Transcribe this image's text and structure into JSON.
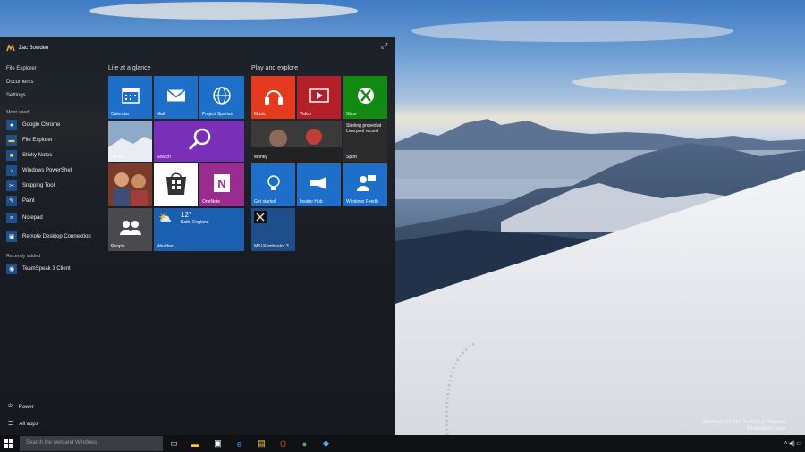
{
  "user": {
    "name": "Zac Bowden"
  },
  "places": [
    "File Explorer",
    "Documents",
    "Settings"
  ],
  "most_used_label": "Most used",
  "most_used": [
    {
      "label": "Google Chrome",
      "icon": "chrome-icon"
    },
    {
      "label": "File Explorer",
      "icon": "folder-icon"
    },
    {
      "label": "Sticky Notes",
      "icon": "sticky-notes-icon"
    },
    {
      "label": "Windows PowerShell",
      "icon": "powershell-icon"
    },
    {
      "label": "Snipping Tool",
      "icon": "scissors-icon"
    },
    {
      "label": "Paint",
      "icon": "paint-icon"
    },
    {
      "label": "Notepad",
      "icon": "notepad-icon"
    },
    {
      "label": "Remote Desktop Connection",
      "icon": "remote-desktop-icon"
    }
  ],
  "recently_added_label": "Recently added",
  "recently_added": [
    {
      "label": "TeamSpeak 3 Client",
      "icon": "teamspeak-icon"
    }
  ],
  "power_label": "Power",
  "all_apps_label": "All apps",
  "groups": {
    "life": "Life at a glance",
    "play": "Play and explore"
  },
  "tiles": {
    "calendar": "Calendar",
    "mail": "Mail",
    "spartan": "Project Spartan",
    "photos": "Photos",
    "search": "Search",
    "store": "Store",
    "onenote": "OneNote",
    "people": "People",
    "weather": "Weather",
    "weather_temp": "12°",
    "weather_loc": "Bath, England",
    "music": "Music",
    "video": "Video",
    "xbox": "Xbox",
    "money": "Money",
    "sport": "Sport",
    "sport_headline": "Sterling proved at Liverpool record",
    "get_started": "Get started",
    "insider_hub": "Insider Hub",
    "windows_feedback": "Windows Feedb",
    "msi": "MSI Kombustor 3"
  },
  "taskbar": {
    "search_placeholder": "Search the web and Windows",
    "icons": [
      "task-view-icon",
      "file-explorer-icon",
      "store-icon",
      "ie-icon",
      "paint-icon",
      "opera-icon",
      "chrome-icon",
      "steam-icon"
    ]
  },
  "watermark": [
    "Windows 10 Pro Technical Preview",
    "Evaluation copy"
  ],
  "colors": {
    "accent_blue": "#1e6fc9",
    "red": "#e53a1e",
    "dark_red": "#b3202a",
    "green": "#128a12",
    "purple": "#7a2fb8",
    "onenote_purple": "#9a2c8f",
    "weather_blue": "#1a5fb0"
  }
}
